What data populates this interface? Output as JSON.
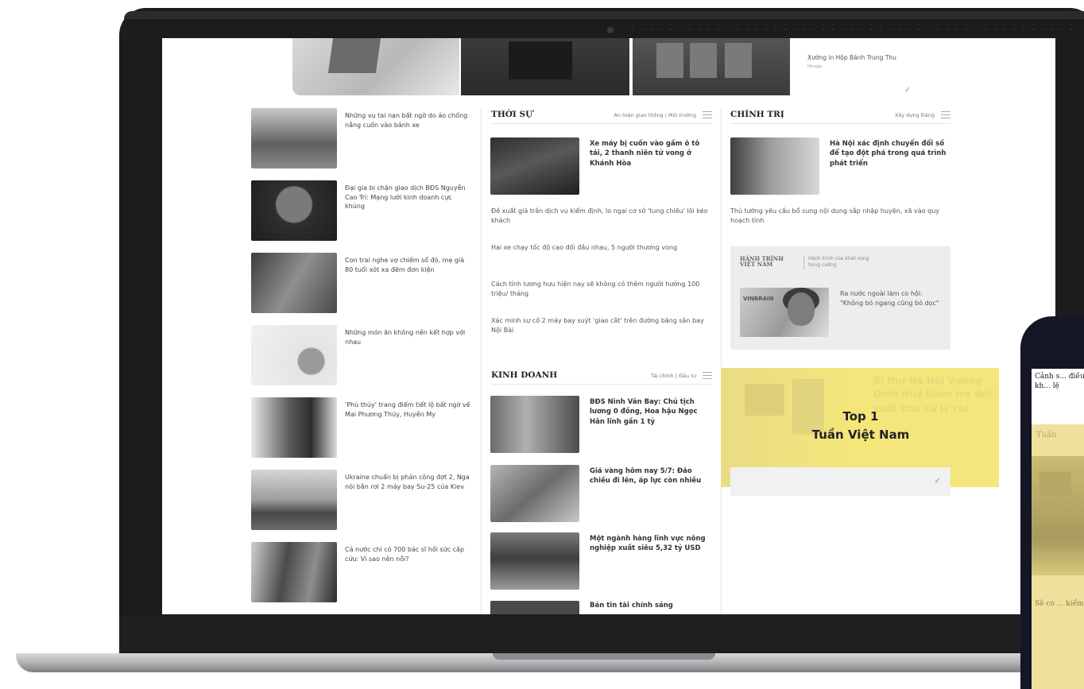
{
  "top_ad": {
    "side_title": "Xưởng in Hộp Bánh Trung Thu",
    "side_source": "Hnuga"
  },
  "left_column": [
    {
      "title": "Những vụ tai nạn bất ngờ do áo chống nắng cuốn vào bánh xe"
    },
    {
      "title": "Đại gia bị chặn giao dịch BĐS Nguyễn Cao Trí: Mạng lưới kinh doanh cực khủng"
    },
    {
      "title": "Con trai nghe vợ chiếm sổ đỏ, mẹ già 80 tuổi xót xa đêm đơn kiện"
    },
    {
      "title": "Những món ăn không nên kết hợp với nhau"
    },
    {
      "title": "'Phù thủy' trang điểm tiết lộ bất ngờ về Mai Phương Thúy, Huyền My"
    },
    {
      "title": "Ukraine chuẩn bị phản công đợt 2, Nga nói bắn rơi 2 máy bay Su-25 của Kiev"
    },
    {
      "title": "Cả nước chỉ có 700 bác sĩ hồi sức cấp cứu: Vì sao nên nỗi?"
    }
  ],
  "thoi_su": {
    "name": "THỜI SỰ",
    "sub": "An toàn giao thông | Môi trường",
    "featured_title": "Xe máy bị cuốn vào gầm ô tô tải, 2 thanh niên tử vong ở Khánh Hòa",
    "links": [
      "Đề xuất giá trần dịch vụ kiểm định, lo ngại cơ sở 'tung chiêu' lôi kéo khách",
      "Hai xe chạy tốc độ cao đối đầu nhau, 5 người thương vong",
      "Cách tính lương hưu hiện nay sẽ không có thêm người hưởng 100 triệu/ tháng",
      "Xác minh sự cố 2 máy bay suýt 'giao cắt' trên đường băng sân bay Nội Bài"
    ]
  },
  "kinh_doanh": {
    "name": "KINH DOANH",
    "sub": "Tài chính | Đầu tư",
    "items": [
      {
        "title": "BĐS Ninh Vân Bay: Chủ tịch lương 0 đồng, Hoa hậu Ngọc Hân lĩnh gần 1 tỷ"
      },
      {
        "title": "Giá vàng hôm nay 5/7: Đảo chiều đi lên, áp lực còn nhiều"
      },
      {
        "title": "Một ngành hàng lĩnh vực nông nghiệp xuất siêu 5,32 tỷ USD"
      },
      {
        "title": "Bản tin tài chính sáng"
      }
    ]
  },
  "chinh_tri": {
    "name": "CHÍNH TRỊ",
    "sub": "Xây dựng Đảng",
    "featured_title": "Hà Nội xác định chuyển đổi số để tạo đột phá trong quá trình phát triển",
    "link": "Thủ tướng yêu cầu bổ sung nội dung sắp nhập huyện, xã vào quy hoạch tỉnh",
    "promo": {
      "logo_line1": "HÀNH TRÌNH",
      "logo_line2": "VIỆT NAM",
      "logo_sub_line1": "Hành trình của khát vọng",
      "logo_sub_line2": "hùng cường",
      "brand": "VINBRAIN",
      "title": "Ra nước ngoài làm co hội: \"Không bỏ ngang cũng bỏ dọc\""
    }
  },
  "top_tuan": {
    "line1": "Top 1",
    "line2": "Tuần Việt Nam",
    "ghost_text": "Bí thư Hà Nội Vương Đình Huệ kiểm tra đột xuất khu xử lý rác"
  },
  "phone": {
    "head": "Cảnh s... điều kh... lệ",
    "tuan": "Tuần",
    "foot": "Sẽ có ... kiểm..."
  }
}
